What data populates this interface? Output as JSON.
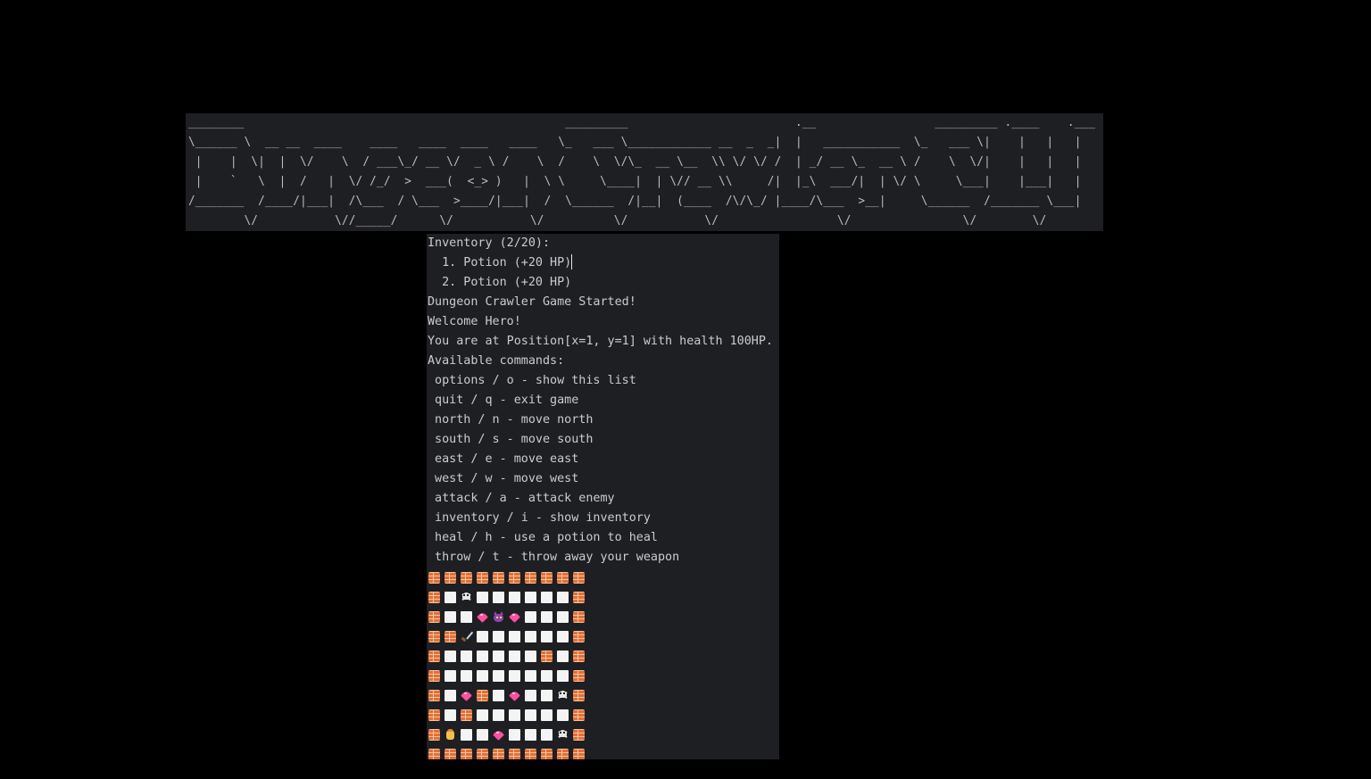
{
  "banner": {
    "ascii_art": "________                                              _________                        .__                 _________ .____    .___\n\\______ \\  __ __  ____    ____   ____  ____   ____   \\_   ___ \\____________ __  _  _|  |   ___________  \\_   ___ \\|    |   |   |\n |    |  \\|  |  \\/    \\  / ___\\_/ __ \\/  _ \\ /    \\  /    \\  \\/\\_  __ \\__  \\\\ \\/ \\/ /  | _/ __ \\_  __ \\ /    \\  \\/|    |   |   |\n |    `   \\  |  /   |  \\/ /_/  >  ___(  <_> )   |  \\ \\     \\____|  | \\// __ \\\\     /|  |_\\  ___/|  | \\/ \\     \\___|    |___|   |\n/_______  /____/|___|  /\\___  / \\___  >____/|___|  /  \\______  /|__|  (____  /\\/\\_/ |____/\\___  >__|     \\______  /_______ \\___|\n        \\/           \\//_____/      \\/           \\/          \\/           \\/                 \\/                \\/        \\/"
  },
  "console": {
    "lines": [
      "Inventory (2/20):",
      "  1. Potion (+20 HP)",
      "  2. Potion (+20 HP)",
      "Dungeon Crawler Game Started!",
      "Welcome Hero!",
      "You are at Position[x=1, y=1] with health 100HP.",
      "Available commands:",
      " options / o - show this list",
      " quit / q - exit game",
      " north / n - move north",
      " south / s - move south",
      " east / e - move east",
      " west / w - move west",
      " attack / a - attack enemy",
      " inventory / i - show inventory",
      " heal / h - use a potion to heal",
      " throw / t - throw away your weapon"
    ]
  },
  "map": {
    "legend": {
      "W": "brick-wall",
      ".": "empty-floor",
      "S": "skull-enemy",
      "H": "heart-potion",
      "D": "demon-enemy",
      "K": "dagger-weapon",
      "P": "hero-player"
    },
    "rows": [
      "WWWWWWWWWW",
      "W.S......W",
      "W..HDH...W",
      "WWK......W",
      "W......W.W",
      "W........W",
      "W.HW.H..SW",
      "W.W......W",
      "WP..H...SW",
      "WWWWWWWWWW"
    ]
  }
}
